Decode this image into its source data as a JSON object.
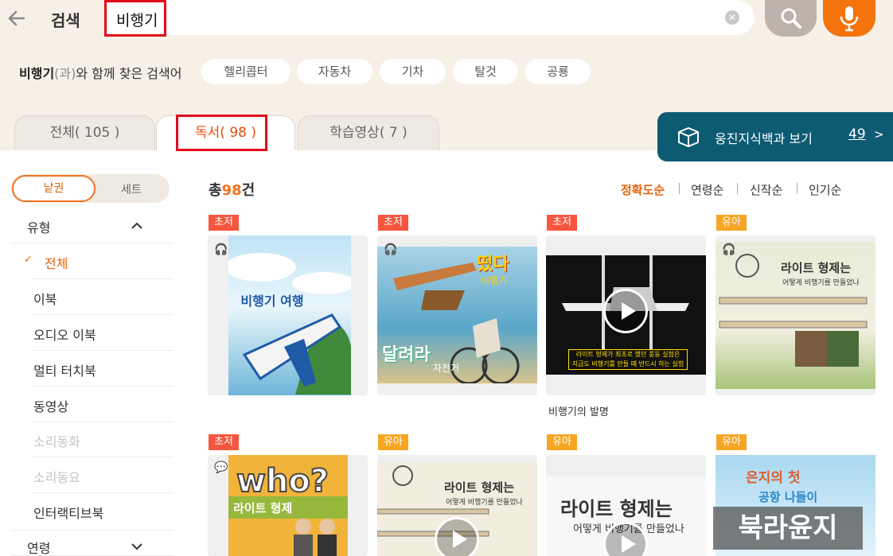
{
  "header": {
    "title": "검색",
    "search_value": "비행기"
  },
  "related": {
    "keyword": "비행기",
    "suffix_gray": "(과)",
    "suffix": "와 함께 찾은 검색어",
    "chips": [
      "헬리콥터",
      "자동차",
      "기차",
      "탈것",
      "공룡"
    ]
  },
  "tabs": [
    {
      "label": "전체( 105 )"
    },
    {
      "label": "독서( 98 )"
    },
    {
      "label": "학습영상( 7 )"
    }
  ],
  "encyclopedia": {
    "label": "웅진지식백과 보기",
    "count": "49",
    "arrow": ">"
  },
  "sidebar": {
    "toggle": {
      "on": "낱권",
      "off": "세트"
    },
    "group_type": "유형",
    "items": [
      "전체",
      "이북",
      "오디오 이북",
      "멀티 터치북",
      "동영상",
      "소리동화",
      "소리동요",
      "인터랙티브북"
    ],
    "group_age": "연령"
  },
  "results": {
    "total_prefix": "총",
    "total_count": "98",
    "total_suffix": "건",
    "sort": [
      "정확도순",
      "연령순",
      "신작순",
      "인기순"
    ],
    "badges": [
      "초저",
      "초저",
      "초저",
      "유아",
      "초저",
      "유아",
      "유아",
      "유아"
    ],
    "video_caption": "비행기의 발명",
    "video_subtitle": [
      "라이트 형제가 최초로 했던 풍동 실험은",
      "지금도 비행기를 만들 때 반드시 하는 실험"
    ],
    "cover_texts": {
      "c1_title": "비행기 여행",
      "c2_top": "떴다",
      "c2_sub": "비행기",
      "c2_bottom": "달려라",
      "c2_bottom_sub": "자전거",
      "c4_title": "라이트 형제는",
      "c4_sub": "어떻게 비행기를 만들었나",
      "c5_title": "who?",
      "c5_sub": "라이트 형제",
      "c6_title": "라이트 형제는",
      "c6_sub": "어떻게 비행기를 만들었나",
      "c7_title": "라이트 형제는",
      "c7_sub": "어떻게 비행기를 만들었나",
      "c8_title": "은지의 첫",
      "c8_sub": "공항 나들이"
    }
  },
  "watermark": "북라윤지",
  "colors": {
    "accent": "#f0731f",
    "highlight": "#e3071b",
    "encyclopedia": "#0d5a73",
    "badge_red": "#f6563f",
    "badge_yellow": "#f5a623"
  }
}
